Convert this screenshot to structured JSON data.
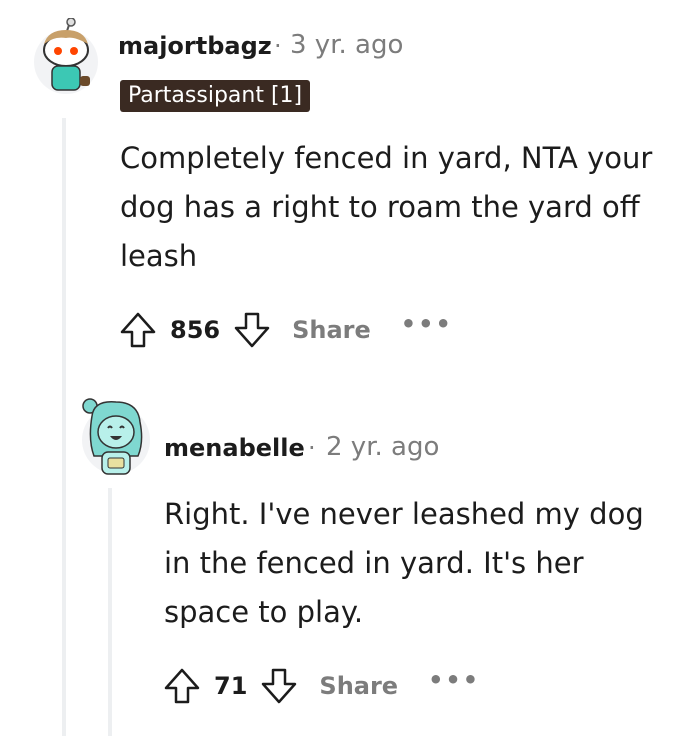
{
  "comments": [
    {
      "username": "majortbagz",
      "separator": "·",
      "age": "3 yr. ago",
      "flair": "Partassipant [1]",
      "body_lines": [
        "Completely fenced in yard, NTA your",
        "dog has a right to roam the yard off",
        "leash"
      ],
      "score": "856",
      "share_label": "Share",
      "more_label": "•••",
      "avatar_icon": "snoo-avatar-icon"
    },
    {
      "username": "menabelle",
      "separator": "·",
      "age": "2 yr. ago",
      "body_lines": [
        "Right. I've never leashed my dog",
        "in the fenced in yard. It's her",
        "space to play."
      ],
      "score": "71",
      "share_label": "Share",
      "more_label": "•••",
      "avatar_icon": "snoo-avatar-icon"
    }
  ],
  "colors": {
    "flair_bg": "#3a2a22",
    "meta_gray": "#7c7c7c",
    "thread_line": "#edeff1",
    "text": "#1c1c1c"
  }
}
